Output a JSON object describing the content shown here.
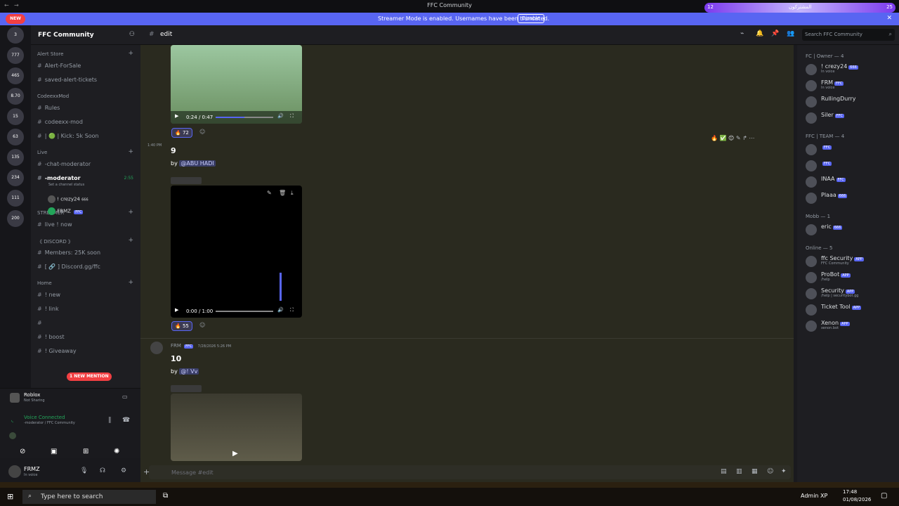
{
  "window": {
    "title": "FFC Community",
    "top_badge_count": "12",
    "top_badge_label": "المشتركون",
    "top_badge_num": "25"
  },
  "banner": {
    "message": "Streamer Mode is enabled. Usernames have been truncated.",
    "button": "Disable"
  },
  "rail": {
    "new_label": "NEW",
    "badges": [
      "3",
      "777",
      "465",
      "8.70",
      "15",
      "63",
      "135",
      "234",
      "111",
      "200"
    ]
  },
  "server": {
    "name": "FFC Community"
  },
  "channels": [
    {
      "type": "cat",
      "label": "Alert Store",
      "plus": true
    },
    {
      "type": "ch",
      "label": "Alert-ForSale"
    },
    {
      "type": "ch",
      "label": "saved-alert-tickets"
    },
    {
      "type": "cat",
      "label": "CodeexxMod"
    },
    {
      "type": "ch",
      "label": "Rules"
    },
    {
      "type": "ch",
      "label": "codeexx-mod"
    },
    {
      "type": "ch",
      "label": "| 🟢 | Kick: 5k Soon"
    },
    {
      "type": "cat",
      "label": "Live",
      "plus": true
    },
    {
      "type": "ch",
      "label": "-chat-moderator"
    },
    {
      "type": "ch",
      "label": "-moderator",
      "active": true,
      "time": "2:55",
      "status": "Set a channel status"
    },
    {
      "type": "cat",
      "label": "STREAMER",
      "plus": true
    },
    {
      "type": "ch",
      "label": "live ! now"
    },
    {
      "type": "cat",
      "label": "《 DISCORD 》",
      "plus": true
    },
    {
      "type": "ch",
      "label": "Members: 25K soon"
    },
    {
      "type": "ch",
      "label": "[ 🔗 ] Discord.gg/ffc"
    },
    {
      "type": "cat",
      "label": "Home",
      "plus": true
    },
    {
      "type": "ch",
      "label": "! new"
    },
    {
      "type": "ch",
      "label": "! link"
    },
    {
      "type": "ch",
      "label": ""
    },
    {
      "type": "ch",
      "label": "! boost"
    },
    {
      "type": "ch",
      "label": "! Giveaway"
    }
  ],
  "voice_users": [
    {
      "name": "! crezy24",
      "tag": "666"
    },
    {
      "name": "FRMZ",
      "tag": "FFC"
    }
  ],
  "new_mention": "1 NEW MENTION",
  "activity": {
    "title": "Roblox",
    "sub": "Not Sharing"
  },
  "voice": {
    "status": "Voice Connected",
    "channel": "-moderator / FFC Community"
  },
  "user": {
    "name": "FRMZ",
    "status": "In voice"
  },
  "chat": {
    "channel": "edit",
    "search_placeholder": "Search FFC Community",
    "composer_placeholder": "Message #edit",
    "msg1": {
      "timestamp": "1:40 PM",
      "number": "9",
      "by": "by",
      "mention": "@ABU HADI",
      "video_time": "0:00 / 1:00",
      "reaction_count": "55"
    },
    "msg0": {
      "video_time": "0:24 / 0:47",
      "reaction_count": "72"
    },
    "msg2": {
      "author": "FRM",
      "tag": "FFC",
      "date": "7/28/2026 5:26 PM",
      "number": "10",
      "by": "by",
      "mention": "@! Vv"
    }
  },
  "members": {
    "groups": [
      {
        "label": "FC | Owner — 4",
        "items": [
          {
            "name": "! crezy24",
            "tag": "666",
            "sub": "In voice"
          },
          {
            "name": "FRM",
            "tag": "FFC",
            "sub": "In voice"
          },
          {
            "name": "RullingDurry",
            "tag": "",
            "sub": ""
          },
          {
            "name": "Siler",
            "tag": "FFC",
            "sub": ""
          }
        ]
      },
      {
        "label": "FFC | TEAM — 4",
        "items": [
          {
            "name": "",
            "tag": "FFC",
            "sub": ""
          },
          {
            "name": "",
            "tag": "FFC",
            "sub": ""
          },
          {
            "name": "INAA",
            "tag": "FFC",
            "sub": ""
          },
          {
            "name": "Plaaa",
            "tag": "666",
            "sub": ""
          }
        ]
      },
      {
        "label": "Mobb — 1",
        "items": [
          {
            "name": "eric",
            "tag": "666",
            "sub": ""
          }
        ]
      },
      {
        "label": "Online — 5",
        "items": [
          {
            "name": "ffc Security",
            "tag": "APP",
            "sub": "FFC Community"
          },
          {
            "name": "ProBot",
            "tag": "APP",
            "sub": "/help"
          },
          {
            "name": "Security",
            "tag": "APP",
            "sub": "/help | securitybot.gg"
          },
          {
            "name": "Ticket Tool",
            "tag": "APP",
            "sub": ""
          },
          {
            "name": "Xenon",
            "tag": "APP",
            "sub": "xenon.bot"
          }
        ]
      }
    ]
  },
  "taskbar": {
    "search_placeholder": "Type here to search",
    "clock_time": "17:48",
    "clock_date": "01/08/2026",
    "user": "Admin XP"
  },
  "colors": {
    "accent": "#5865f2",
    "danger": "#f23f42",
    "online": "#23a55a",
    "chat_bg": "#2a2a1f"
  }
}
